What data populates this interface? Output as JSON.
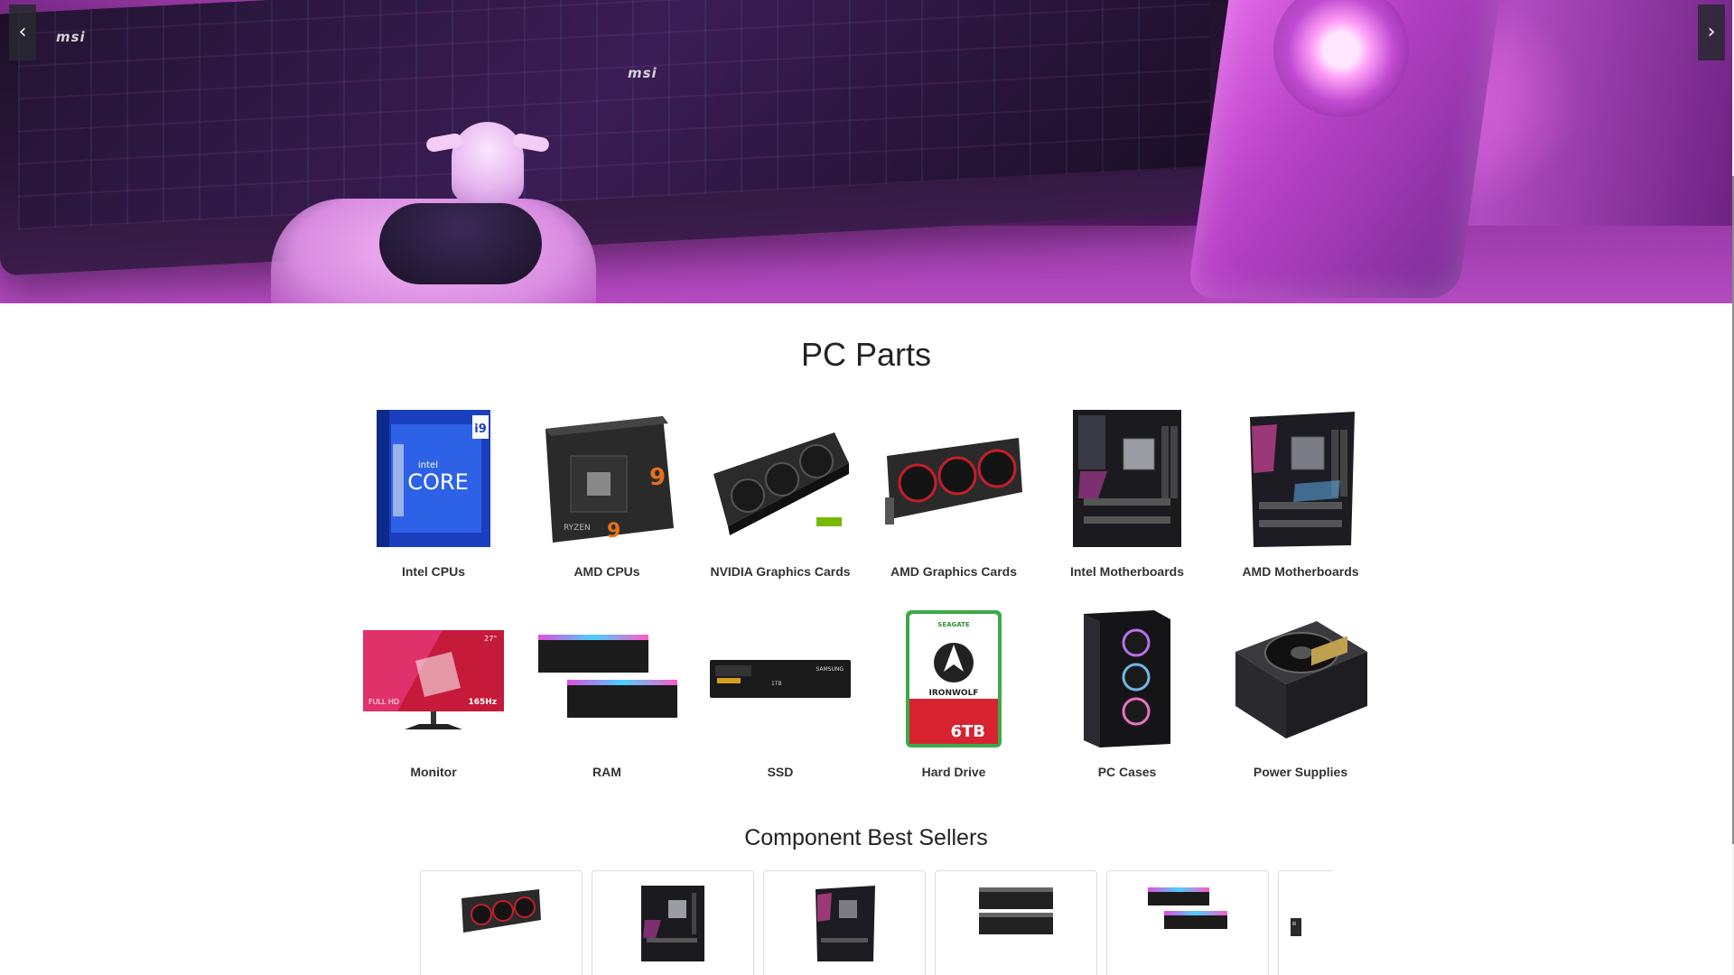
{
  "hero": {
    "brand_left": "msi",
    "brand_center": "msi",
    "brand_bottom": "msi",
    "prev_label": "‹",
    "next_label": "›"
  },
  "parts": {
    "title": "PC Parts",
    "items": [
      {
        "label": "Intel CPUs",
        "icon": "intel-cpu-box-icon"
      },
      {
        "label": "AMD CPUs",
        "icon": "amd-cpu-box-icon"
      },
      {
        "label": "NVIDIA Graphics Cards",
        "icon": "nvidia-gpu-icon"
      },
      {
        "label": "AMD Graphics Cards",
        "icon": "amd-gpu-icon"
      },
      {
        "label": "Intel Motherboards",
        "icon": "intel-motherboard-icon"
      },
      {
        "label": "AMD Motherboards",
        "icon": "amd-motherboard-icon"
      },
      {
        "label": "Monitor",
        "icon": "monitor-icon"
      },
      {
        "label": "RAM",
        "icon": "ram-icon"
      },
      {
        "label": "SSD",
        "icon": "ssd-icon"
      },
      {
        "label": "Hard Drive",
        "icon": "hard-drive-icon"
      },
      {
        "label": "PC Cases",
        "icon": "pc-case-icon"
      },
      {
        "label": "Power Supplies",
        "icon": "power-supply-icon"
      }
    ],
    "intel_box_text": "CORE",
    "intel_brand": "intel",
    "intel_badge": "i9",
    "amd_box_text": "RYZEN",
    "amd_badge": "9",
    "monitor_size": "27\"",
    "monitor_hz": "165Hz",
    "monitor_res": "FULL HD",
    "ssd_brand": "SAMSUNG",
    "ssd_cap": "1TB",
    "hdd_brand": "SEAGATE",
    "hdd_name": "IRONWOLF",
    "hdd_cap": "6TB"
  },
  "best_sellers": {
    "title": "Component Best Sellers",
    "items": [
      {
        "icon": "gpu-icon"
      },
      {
        "icon": "motherboard-icon"
      },
      {
        "icon": "motherboard-icon"
      },
      {
        "icon": "ram-icon"
      },
      {
        "icon": "ram-icon"
      },
      {
        "icon": "component-icon"
      }
    ]
  },
  "colors": {
    "hero_accent": "#c44dc6",
    "text": "#333333",
    "card_border": "#dcdcdc"
  }
}
